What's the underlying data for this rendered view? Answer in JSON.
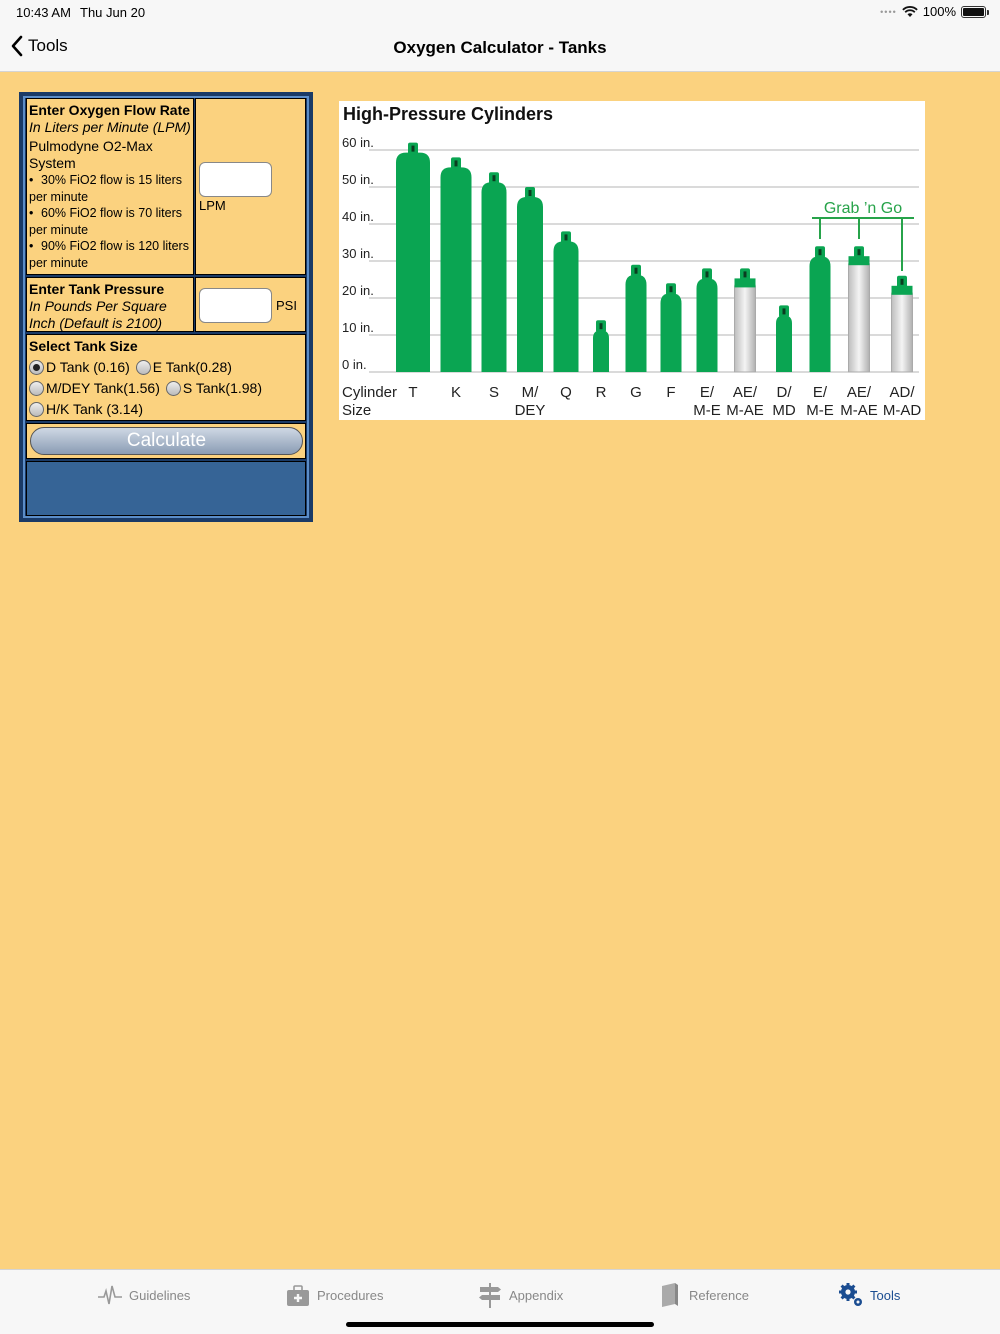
{
  "status": {
    "time": "10:43 AM",
    "date": "Thu Jun 20",
    "battery": "100%"
  },
  "nav": {
    "back_label": "Tools",
    "title": "Oxygen Calculator - Tanks"
  },
  "flow": {
    "title": "Enter Oxygen Flow Rate",
    "subtitle": "In Liters per Minute (LPM)",
    "system": "Pulmodyne O2-Max System",
    "bullets": [
      "30% FiO2 flow is 15 liters per minute",
      "60% FiO2 flow is 70 liters per minute",
      "90% FiO2 flow is 120 liters per minute"
    ],
    "value": "",
    "unit": "LPM"
  },
  "pressure": {
    "title": "Enter Tank Pressure",
    "subtitle": "In Pounds Per Square Inch (Default is 2100)",
    "value": "",
    "unit": "PSI"
  },
  "tank": {
    "title": "Select Tank Size",
    "options": [
      "D Tank (0.16)",
      "E Tank(0.28)",
      "M/DEY Tank(1.56)",
      "S Tank(1.98)",
      "H/K Tank (3.14)"
    ],
    "selected": "D Tank (0.16)"
  },
  "calculate_label": "Calculate",
  "chart_data": {
    "type": "bar",
    "title": "High-Pressure Cylinders",
    "ylabel": "",
    "xlabel": "Cylinder Size",
    "yticks": [
      "60 in.",
      "50 in.",
      "40 in.",
      "30 in.",
      "20 in.",
      "10 in.",
      "0 in."
    ],
    "ylim": [
      0,
      60
    ],
    "grid": true,
    "categories": [
      "T",
      "K",
      "S",
      "M/ DEY",
      "Q",
      "R",
      "G",
      "F",
      "E/ M-E",
      "AE/ M-AE",
      "D/ MD",
      "E/ M-E",
      "AE/ M-AE",
      "AD/ M-AD"
    ],
    "values": [
      62,
      58,
      54,
      50,
      38,
      14,
      29,
      24,
      28,
      28,
      18,
      34,
      34,
      26
    ],
    "materials": [
      "steel",
      "steel",
      "steel",
      "steel",
      "steel",
      "steel",
      "steel",
      "steel",
      "steel",
      "aluminum",
      "steel",
      "steel",
      "aluminum",
      "aluminum"
    ],
    "annotation": "Grab ’n Go",
    "colors": {
      "green": "#0aa552",
      "aluminum": "#d7d7d7",
      "annotation": "#27a34a"
    }
  },
  "tabs": [
    {
      "label": "Guidelines",
      "icon": "pulse-icon",
      "active": false
    },
    {
      "label": "Procedures",
      "icon": "medkit-icon",
      "active": false
    },
    {
      "label": "Appendix",
      "icon": "signpost-icon",
      "active": false
    },
    {
      "label": "Reference",
      "icon": "book-icon",
      "active": false
    },
    {
      "label": "Tools",
      "icon": "gears-icon",
      "active": true
    }
  ]
}
